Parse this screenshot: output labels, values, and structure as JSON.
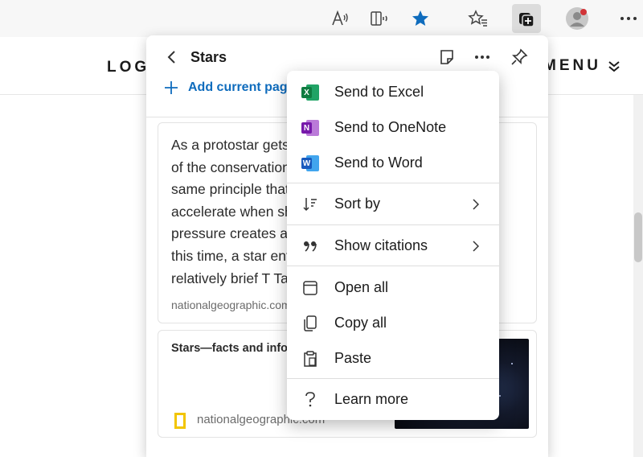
{
  "colors": {
    "accent_blue": "#0f6cbd",
    "excel_green": "#107c41",
    "onenote_purple": "#7719aa",
    "word_blue": "#185abd",
    "notification_red": "#d13438",
    "natgeo_yellow": "#f2c500"
  },
  "toolbar": {
    "icons": [
      "read-aloud-icon",
      "immersive-reader-icon",
      "favorite-star-icon",
      "favorites-icon",
      "collections-icon",
      "profile-icon",
      "more-icon"
    ]
  },
  "page": {
    "logo": "LOGO",
    "menu_label": "MENU"
  },
  "collection": {
    "title": "Stars",
    "add_current_page": "Add current page",
    "note_lines": [
      "As a protostar gets denser, because",
      "of the conservation of angular momentum, the",
      "same principle that causes a figure skater to",
      "accelerate when she pulls her arms in, the rising",
      "pressure creates a hot dense core. During",
      "this time, a star enters a",
      "relatively brief T Tauri phase."
    ],
    "note_source": "nationalgeographic.com",
    "card_title": "Stars—facts and information",
    "card_source": "nationalgeographic.com"
  },
  "context_menu": {
    "items": [
      {
        "label": "Send to Excel",
        "icon": "excel-icon"
      },
      {
        "label": "Send to OneNote",
        "icon": "onenote-icon"
      },
      {
        "label": "Send to Word",
        "icon": "word-icon"
      },
      {
        "label": "Sort by",
        "icon": "sort-icon",
        "submenu": true
      },
      {
        "label": "Show citations",
        "icon": "citation-icon",
        "submenu": true
      },
      {
        "label": "Open all",
        "icon": "open-all-icon"
      },
      {
        "label": "Copy all",
        "icon": "copy-icon"
      },
      {
        "label": "Paste",
        "icon": "paste-icon"
      },
      {
        "label": "Learn more",
        "icon": "help-icon"
      }
    ],
    "app_letters": {
      "excel": "X",
      "onenote": "N",
      "word": "W"
    }
  }
}
